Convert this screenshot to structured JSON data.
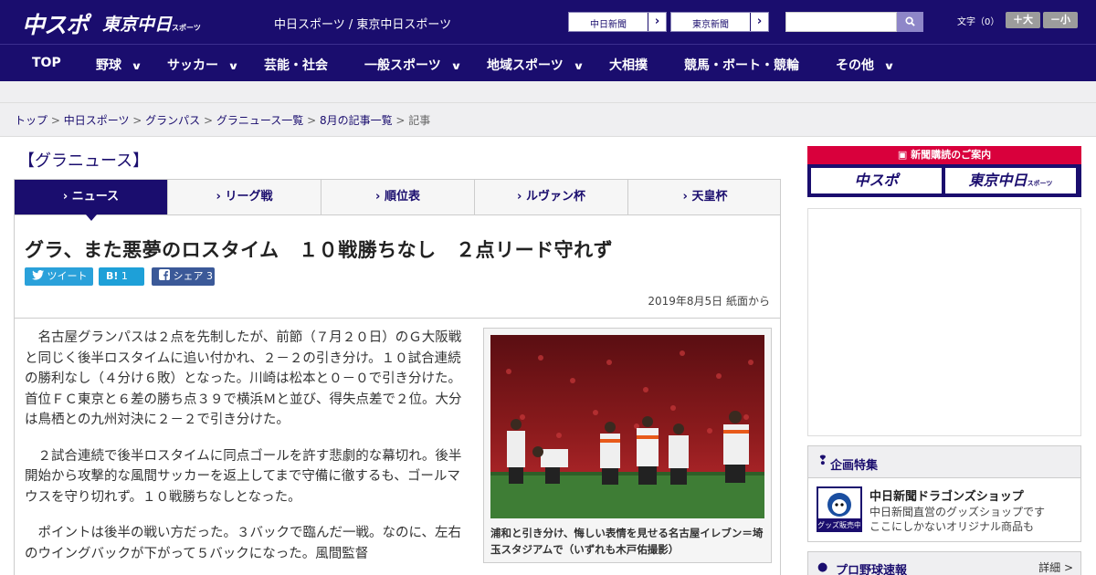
{
  "header": {
    "logo_main": "中スポ",
    "logo_tokyo": "東京中日",
    "logo_tokyo_small": "スポーツ",
    "site_link": "中日スポーツ / 東京中日スポーツ",
    "ext_chunichi": "中日新聞",
    "ext_tokyo": "東京新聞",
    "font_label": "文字（0）",
    "font_up": "＋大",
    "font_down": "－小"
  },
  "nav": [
    {
      "label": "TOP",
      "dropdown": false
    },
    {
      "label": "野球",
      "dropdown": true
    },
    {
      "label": "サッカー",
      "dropdown": true
    },
    {
      "label": "芸能・社会",
      "dropdown": false
    },
    {
      "label": "一般スポーツ",
      "dropdown": true
    },
    {
      "label": "地域スポーツ",
      "dropdown": true
    },
    {
      "label": "大相撲",
      "dropdown": false
    },
    {
      "label": "競馬・ボート・競輪",
      "dropdown": false
    },
    {
      "label": "その他",
      "dropdown": true
    }
  ],
  "breadcrumb": {
    "items": [
      "トップ",
      "中日スポーツ",
      "グランパス",
      "グラニュース一覧",
      "8月の記事一覧"
    ],
    "current": "記事",
    "separator": " > "
  },
  "section_title": "【グラニュース】",
  "tabs": [
    "ニュース",
    "リーグ戦",
    "順位表",
    "ルヴァン杯",
    "天皇杯"
  ],
  "article": {
    "headline": "グラ、また悪夢のロスタイム　１０戦勝ちなし　２点リード守れず",
    "tweet": "ツイート",
    "hatena_label": "B!",
    "hatena_count": "1",
    "share_label": "シェア",
    "share_count": "3",
    "date": "2019年8月5日 紙面から",
    "paragraphs": [
      "名古屋グランパスは２点を先制したが、前節（７月２０日）のＧ大阪戦と同じく後半ロスタイムに追い付かれ、２－２の引き分け。１０試合連続の勝利なし（４分け６敗）となった。川崎は松本と０－０で引き分けた。首位ＦＣ東京と６差の勝ち点３９で横浜Ｍと並び、得失点差で２位。大分は鳥栖との九州対決に２－２で引き分けた。",
      "２試合連続で後半ロスタイムに同点ゴールを許す悲劇的な幕切れ。後半開始から攻撃的な風間サッカーを返上してまで守備に徹するも、ゴールマウスを守り切れず。１０戦勝ちなしとなった。",
      "ポイントは後半の戦い方だった。３バックで臨んだ一戦。なのに、左右のウイングバックが下がって５バックになった。風間監督"
    ],
    "caption": "浦和と引き分け、悔しい表情を見せる名古屋イレブン＝埼玉スタジアムで（いずれも木戸佑撮影）"
  },
  "sidebar": {
    "promo_head": "新聞購読のご案内",
    "promo_left": "中スポ",
    "promo_right": "東京中日",
    "promo_right_small": "スポーツ",
    "feature_title": "企画特集",
    "shop_title": "中日新聞ドラゴンズショップ",
    "shop_desc1": "中日新聞直営のグッズショップです",
    "shop_desc2": "ここにしかないオリジナル商品も",
    "shop_badge": "グッズ販売中",
    "baseball_title": "プロ野球速報",
    "baseball_more": "詳細 >"
  },
  "colors": {
    "brand": "#1a0d6e",
    "accent_red": "#d9003c",
    "twitter": "#2aa1da",
    "facebook": "#3b5998"
  }
}
